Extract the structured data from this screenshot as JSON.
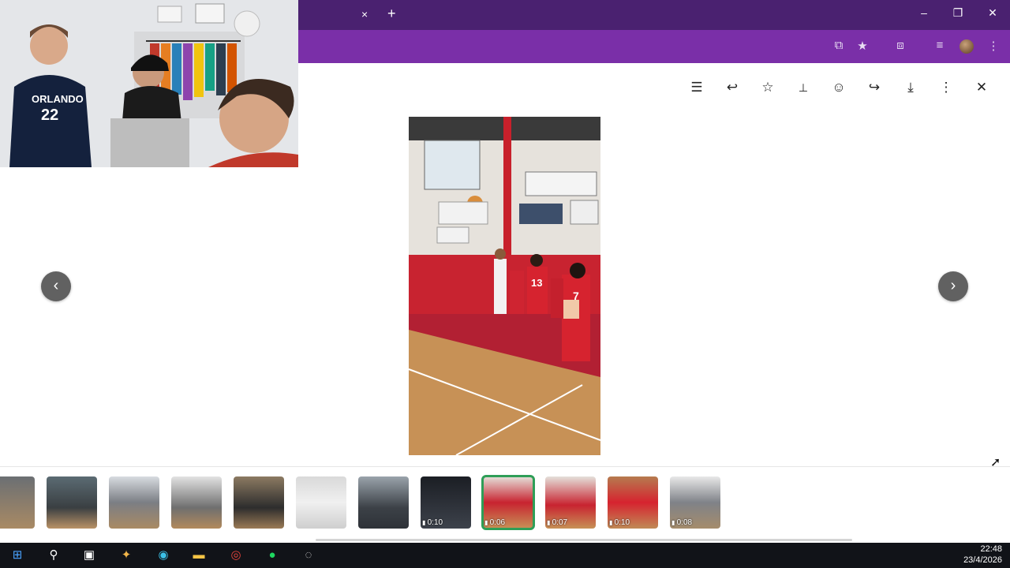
{
  "browser": {
    "tab_close_icon": "×",
    "new_tab_icon": "+",
    "minimize_icon": "–",
    "restore_icon": "❐",
    "close_icon": "✕",
    "toolbar_icons": [
      "install-app-icon",
      "star-icon",
      "extensions-icon",
      "media-controls-icon",
      "profile-avatar",
      "menu-icon"
    ]
  },
  "viewer": {
    "actions": [
      {
        "name": "details-icon",
        "glyph": "☰"
      },
      {
        "name": "reply-icon",
        "glyph": "↩"
      },
      {
        "name": "star-icon",
        "glyph": "☆"
      },
      {
        "name": "pin-icon",
        "glyph": "📌"
      },
      {
        "name": "emoji-icon",
        "glyph": "☺"
      },
      {
        "name": "forward-icon",
        "glyph": "↪"
      },
      {
        "name": "download-icon",
        "glyph": "⤓"
      },
      {
        "name": "more-icon",
        "glyph": "⋮"
      },
      {
        "name": "close-icon",
        "glyph": "✕"
      }
    ],
    "prev_icon": "‹",
    "next_icon": "›"
  },
  "thumbnails": [
    {
      "label": ""
    },
    {
      "label": ""
    },
    {
      "label": ""
    },
    {
      "label": ""
    },
    {
      "label": ""
    },
    {
      "label": ""
    },
    {
      "label": ""
    },
    {
      "label": "0:10"
    },
    {
      "label": "0:06",
      "selected": true
    },
    {
      "label": "0:07"
    },
    {
      "label": "0:10"
    },
    {
      "label": "0:08"
    }
  ],
  "taskbar": {
    "time": "22:48",
    "date": "23/4/2026"
  },
  "colors": {
    "tabbar": "#4a2170",
    "toolbar": "#7a2fa8",
    "selected_thumb": "#2e9e57"
  }
}
